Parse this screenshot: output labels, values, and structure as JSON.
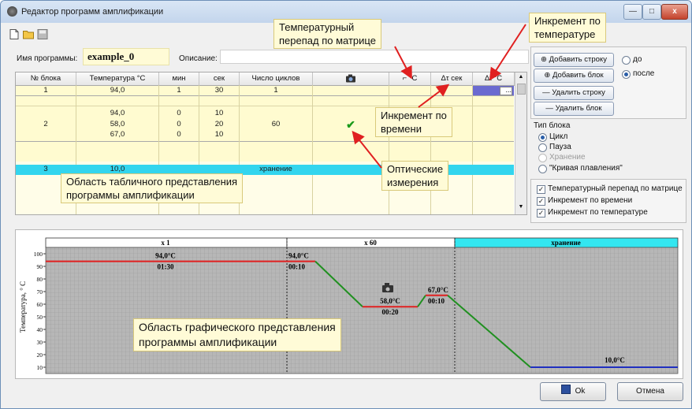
{
  "window": {
    "title": "Редактор программ амплификации",
    "controls": {
      "minimize": "—",
      "maximize": "□",
      "close": "x"
    }
  },
  "toolbar": {
    "icons": [
      "new-file-icon",
      "open-folder-icon",
      "save-icon"
    ]
  },
  "program": {
    "name_label": "Имя программы:",
    "name_value": "example_0",
    "desc_label": "Описание:",
    "desc_value": ""
  },
  "table": {
    "headers": [
      "№ блока",
      "Температура °С",
      "мин",
      "сек",
      "Число циклов",
      "",
      "⌐ °С",
      "Δτ сек",
      "Δt °С"
    ],
    "rows": [
      {
        "block": "1",
        "temp": "94,0",
        "min": "1",
        "sec": "30",
        "cycles": "1",
        "optic": "",
        "d1": "",
        "d2": "",
        "d3": "..."
      },
      {
        "block": "",
        "temp": "",
        "min": "",
        "sec": "",
        "cycles": "",
        "optic": "",
        "d1": "",
        "d2": "",
        "d3": ""
      },
      {
        "block": "",
        "temp": "94,0",
        "min": "0",
        "sec": "10",
        "cycles": "",
        "optic": "",
        "d1": "",
        "d2": "",
        "d3": ""
      },
      {
        "block": "2",
        "temp": "58,0",
        "min": "0",
        "sec": "20",
        "cycles": "60",
        "optic": "✔",
        "d1": "",
        "d2": "",
        "d3": ""
      },
      {
        "block": "",
        "temp": "67,0",
        "min": "0",
        "sec": "10",
        "cycles": "",
        "optic": "",
        "d1": "",
        "d2": "",
        "d3": ""
      },
      {
        "block": "",
        "temp": "",
        "min": "",
        "sec": "",
        "cycles": "",
        "optic": "",
        "d1": "",
        "d2": "",
        "d3": ""
      },
      {
        "block": "3",
        "temp": "10,0",
        "min": "",
        "sec": "",
        "cycles": "хранение",
        "optic": "",
        "d1": "",
        "d2": "",
        "d3": ""
      }
    ]
  },
  "right_panel": {
    "add_row": "Добавить строку",
    "add_block": "Добавить блок",
    "before": "до",
    "after": "после",
    "remove_row": "Удалить строку",
    "remove_block": "Удалить блок",
    "block_type_label": "Тип блока",
    "block_types": [
      "Цикл",
      "Пауза",
      "Хранение",
      "\"Кривая плавления\""
    ],
    "options": [
      "Температурный перепад по матрице",
      "Инкремент по времени",
      "Инкремент по температуре"
    ]
  },
  "callouts": {
    "matrix_gradient": "Температурный\nперепад по матрице",
    "temp_increment": "Инкремент по\nтемпературе",
    "time_increment": "Инкремент по\nвремени",
    "optical": "Оптические\nизмерения",
    "table_area": "Область табличного представления\nпрограммы амплификации",
    "graph_area": "Область графического представления\nпрограммы амплификации"
  },
  "chart_data": {
    "type": "line",
    "ylabel": "Температура, ° С",
    "ylim": [
      5,
      105
    ],
    "yticks": [
      10,
      20,
      30,
      40,
      50,
      60,
      70,
      80,
      90,
      100
    ],
    "header_sections": [
      "x 1",
      "x 60",
      "хранение"
    ],
    "steps": [
      {
        "temp_label": "94,0°C",
        "time_label": "01:30",
        "value": 94,
        "color": "#e02020"
      },
      {
        "temp_label": "94,0°C",
        "time_label": "00:10",
        "value": 94,
        "color": "#e02020"
      },
      {
        "temp_label": "58,0°C",
        "time_label": "00:20",
        "value": 58,
        "color": "#e02020"
      },
      {
        "temp_label": "67,0°C",
        "time_label": "00:10",
        "value": 67,
        "color": "#e02020"
      },
      {
        "temp_label": "10,0°C",
        "time_label": "",
        "value": 10,
        "color": "#2030c0"
      }
    ],
    "ramp_color": "#209020",
    "header_color_storage": "#33e6f0"
  },
  "buttons": {
    "ok": "Ok",
    "cancel": "Отмена"
  },
  "colors": {
    "accent_yellow": "#fffbd6",
    "selected_row": "#33d5ee",
    "arrow": "#e02020"
  }
}
